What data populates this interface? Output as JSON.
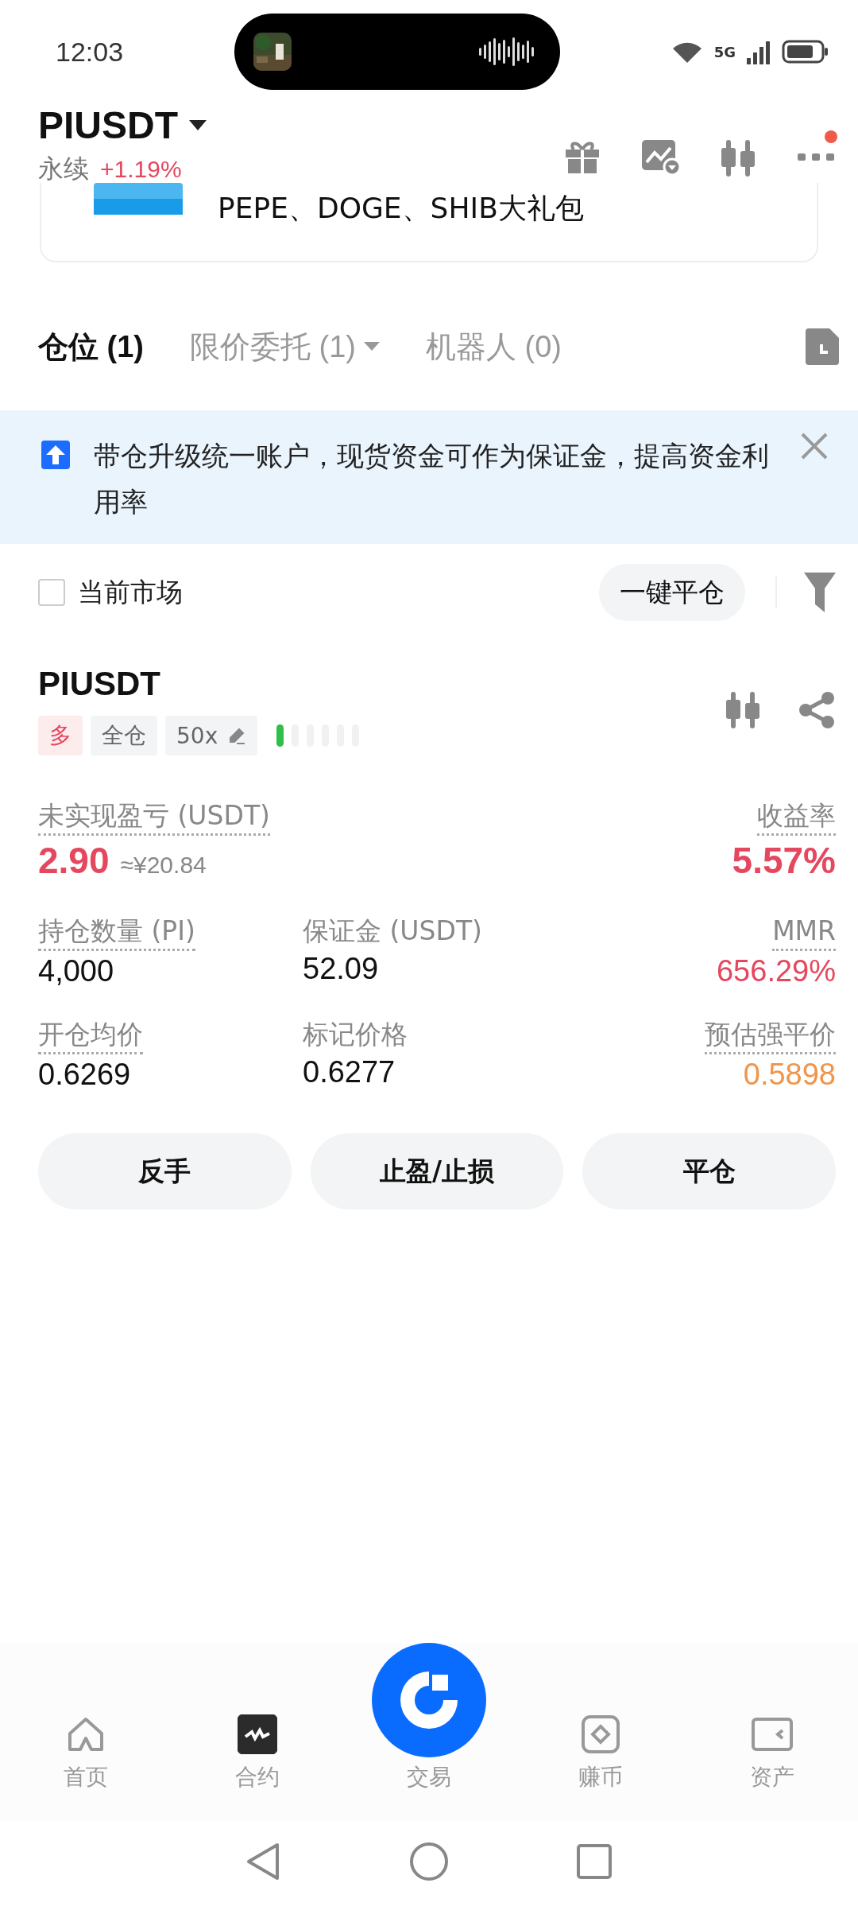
{
  "status_bar": {
    "time": "12:03",
    "network": "5G"
  },
  "header": {
    "symbol": "PIUSDT",
    "type": "永续",
    "change": "+1.19%",
    "notification_dot": true
  },
  "promo_card": {
    "text": "PEPE、DOGE、SHIB大礼包"
  },
  "tabs": [
    {
      "label": "仓位 (1)",
      "selected": true,
      "dropdown": false
    },
    {
      "label": "限价委托 (1)",
      "selected": false,
      "dropdown": true
    },
    {
      "label": "机器人 (0)",
      "selected": false,
      "dropdown": false
    }
  ],
  "notice": {
    "text": "带仓升级统一账户，现货资金可作为保证金，提高资金利用率"
  },
  "filter": {
    "label": "当前市场",
    "checked": false,
    "close_all": "一键平仓"
  },
  "position": {
    "symbol": "PIUSDT",
    "side": "多",
    "margin_mode": "全仓",
    "leverage": "50x",
    "pnl": {
      "label": "未实现盈亏 (USDT)",
      "value": "2.90",
      "approx": "≈¥20.84",
      "roe_label": "收益率",
      "roe": "5.57%"
    },
    "stats": [
      {
        "label": "持仓数量 (PI)",
        "value": "4,000",
        "color": "#111111"
      },
      {
        "label": "保证金 (USDT)",
        "value": "52.09",
        "color": "#111111"
      },
      {
        "label": "MMR",
        "value": "656.29%",
        "color": "#e5475e"
      },
      {
        "label": "开仓均价",
        "value": "0.6269",
        "color": "#111111"
      },
      {
        "label": "标记价格",
        "value": "0.6277",
        "color": "#111111"
      },
      {
        "label": "预估强平价",
        "value": "0.5898",
        "color": "#f0954a"
      }
    ],
    "actions": [
      "反手",
      "止盈/止损",
      "平仓"
    ]
  },
  "bottom_nav": [
    {
      "label": "首页",
      "kind": "home",
      "selected": false
    },
    {
      "label": "合约",
      "kind": "futures",
      "selected": true
    },
    {
      "label": "交易",
      "kind": "trade",
      "selected": false
    },
    {
      "label": "赚币",
      "kind": "earn",
      "selected": false
    },
    {
      "label": "资产",
      "kind": "assets",
      "selected": false
    }
  ]
}
